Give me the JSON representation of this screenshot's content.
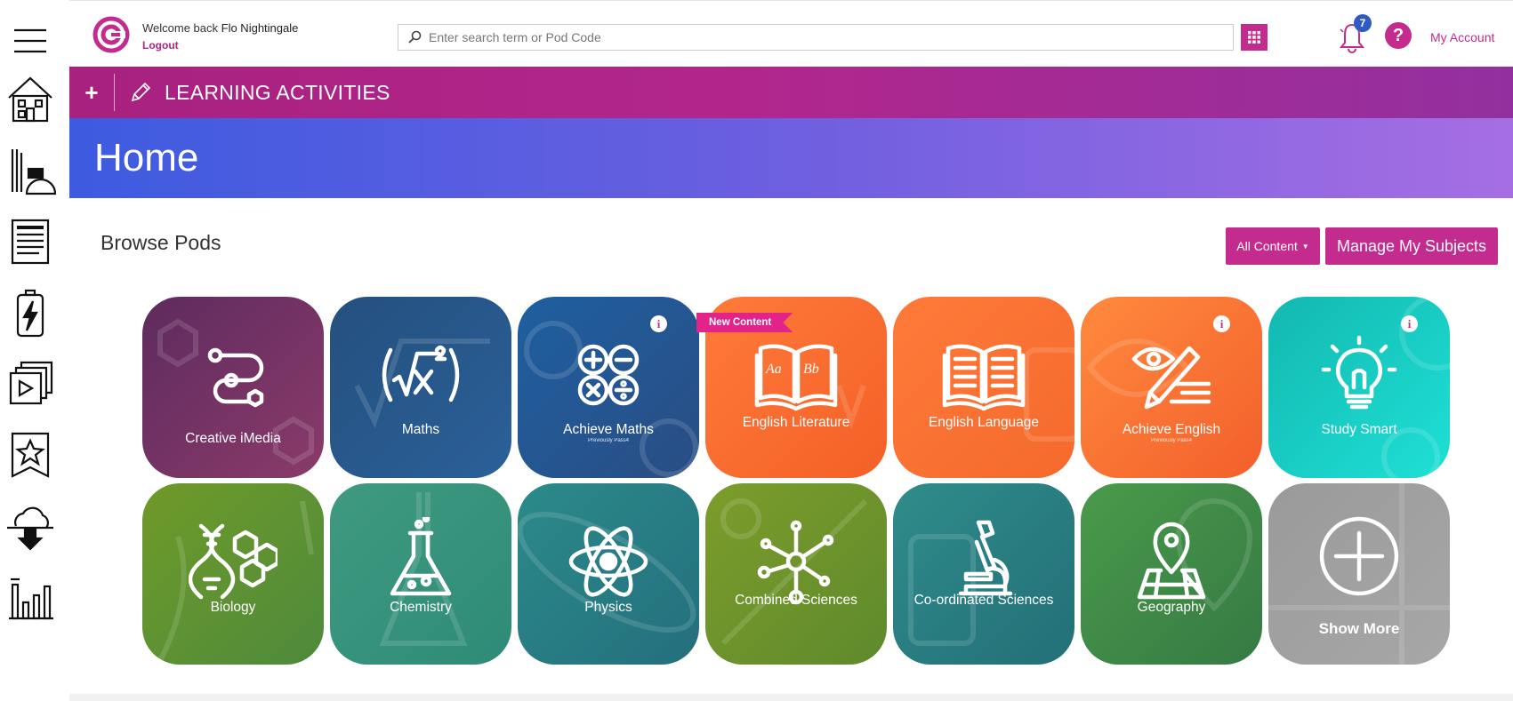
{
  "header": {
    "welcome_prefix": "Welcome back",
    "user_name": "Flo Nightingale",
    "logout": "Logout",
    "search_placeholder": "Enter search term or Pod Code",
    "notification_count": "7",
    "help": "?",
    "my_account": "My Account"
  },
  "activity_bar": {
    "plus": "+",
    "label": "LEARNING ACTIVITIES"
  },
  "hero": {
    "title": "Home"
  },
  "browse": {
    "title": "Browse Pods",
    "all_content": "All Content",
    "manage_subjects": "Manage My Subjects",
    "new_content_tag": "New Content",
    "info_glyph": "i"
  },
  "pods": [
    {
      "label": "Creative iMedia",
      "sub": "",
      "icon": "circuit-icon",
      "color_a": "#5e2b5e",
      "color_b": "#8a3b6a"
    },
    {
      "label": "Maths",
      "sub": "",
      "icon": "square-root-icon",
      "color_a": "#24507e",
      "color_b": "#2b6099"
    },
    {
      "label": "Achieve Maths",
      "sub": "Previously Pass4",
      "icon": "math-operators-icon",
      "color_a": "#1e5fa0",
      "color_b": "#2a4d83"
    },
    {
      "label": "English Literature",
      "sub": "",
      "icon": "open-book-aa-icon",
      "color_a": "#ff7a3a",
      "color_b": "#f46027"
    },
    {
      "label": "English Language",
      "sub": "",
      "icon": "open-book-lines-icon",
      "color_a": "#ff7a3a",
      "color_b": "#f46a2c"
    },
    {
      "label": "Achieve English",
      "sub": "Previously Pass4",
      "icon": "eye-pencil-icon",
      "color_a": "#ff8a3d",
      "color_b": "#f35f2c"
    },
    {
      "label": "Study Smart",
      "sub": "",
      "icon": "lightbulb-icon",
      "color_a": "#12b8b0",
      "color_b": "#1fe0d6"
    },
    {
      "label": "Biology",
      "sub": "",
      "icon": "dna-icon",
      "color_a": "#6f9a28",
      "color_b": "#4e8a3c"
    },
    {
      "label": "Chemistry",
      "sub": "",
      "icon": "flask-icon",
      "color_a": "#3f9a80",
      "color_b": "#2e8b77"
    },
    {
      "label": "Physics",
      "sub": "",
      "icon": "atom-icon",
      "color_a": "#2b8a8a",
      "color_b": "#246f7d"
    },
    {
      "label": "Combined Sciences",
      "sub": "",
      "icon": "molecule-icon",
      "color_a": "#7d9c2b",
      "color_b": "#5e8a2c"
    },
    {
      "label": "Co-ordinated Sciences",
      "sub": "",
      "icon": "microscope-icon",
      "color_a": "#2f8c8a",
      "color_b": "#236f78"
    },
    {
      "label": "Geography",
      "sub": "",
      "icon": "map-pin-icon",
      "color_a": "#4a9a4a",
      "color_b": "#357a44"
    },
    {
      "label": "Show More",
      "sub": "",
      "icon": "plus-circle-icon",
      "color_a": "#9a9a9a",
      "color_b": "#a7a7a7"
    }
  ],
  "sidebar": {
    "items": [
      {
        "icon": "menu-icon"
      },
      {
        "icon": "home-icon"
      },
      {
        "icon": "stationery-icon"
      },
      {
        "icon": "document-icon"
      },
      {
        "icon": "battery-bolt-icon"
      },
      {
        "icon": "video-stack-icon"
      },
      {
        "icon": "star-bookmark-icon"
      },
      {
        "icon": "cloud-download-icon"
      },
      {
        "icon": "bar-chart-icon"
      }
    ]
  },
  "colors": {
    "brand_pink": "#c42b8e",
    "badge_blue": "#2f5bc2"
  }
}
